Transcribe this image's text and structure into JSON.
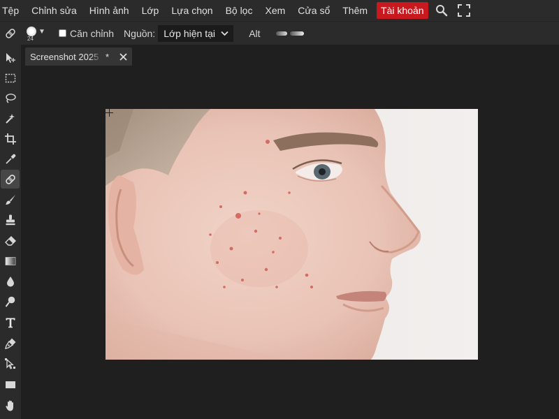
{
  "menu": {
    "items": [
      "Tệp",
      "Chỉnh sửa",
      "Hình ảnh",
      "Lớp",
      "Lựa chọn",
      "Bộ lọc",
      "Xem",
      "Cửa sổ",
      "Thêm"
    ],
    "account_label": "Tài khoản",
    "account_color": "#c8191e",
    "right_icons": [
      "search-icon",
      "fullscreen-icon"
    ]
  },
  "options": {
    "tool_icon": "healing-brush-icon",
    "brush_size": "24",
    "align_label": "Căn chỉnh",
    "align_checked": false,
    "source_label": "Nguồn:",
    "source_value": "Lớp hiện tại",
    "alt_label": "Alt"
  },
  "toolbar": {
    "tools": [
      "move",
      "marquee",
      "lasso",
      "magic-wand",
      "crop",
      "eyedropper",
      "healing-brush",
      "brush",
      "clone-stamp",
      "eraser",
      "gradient",
      "blur",
      "dodge",
      "type",
      "pen",
      "path-select",
      "rectangle",
      "hand"
    ],
    "active": "healing-brush"
  },
  "document": {
    "tab_title": "Screenshot 2025",
    "tab_modified": "*"
  },
  "colors": {
    "app_bg": "#1f1f1f",
    "panel_bg": "#2b2b2b",
    "active_tool_bg": "#474747"
  }
}
